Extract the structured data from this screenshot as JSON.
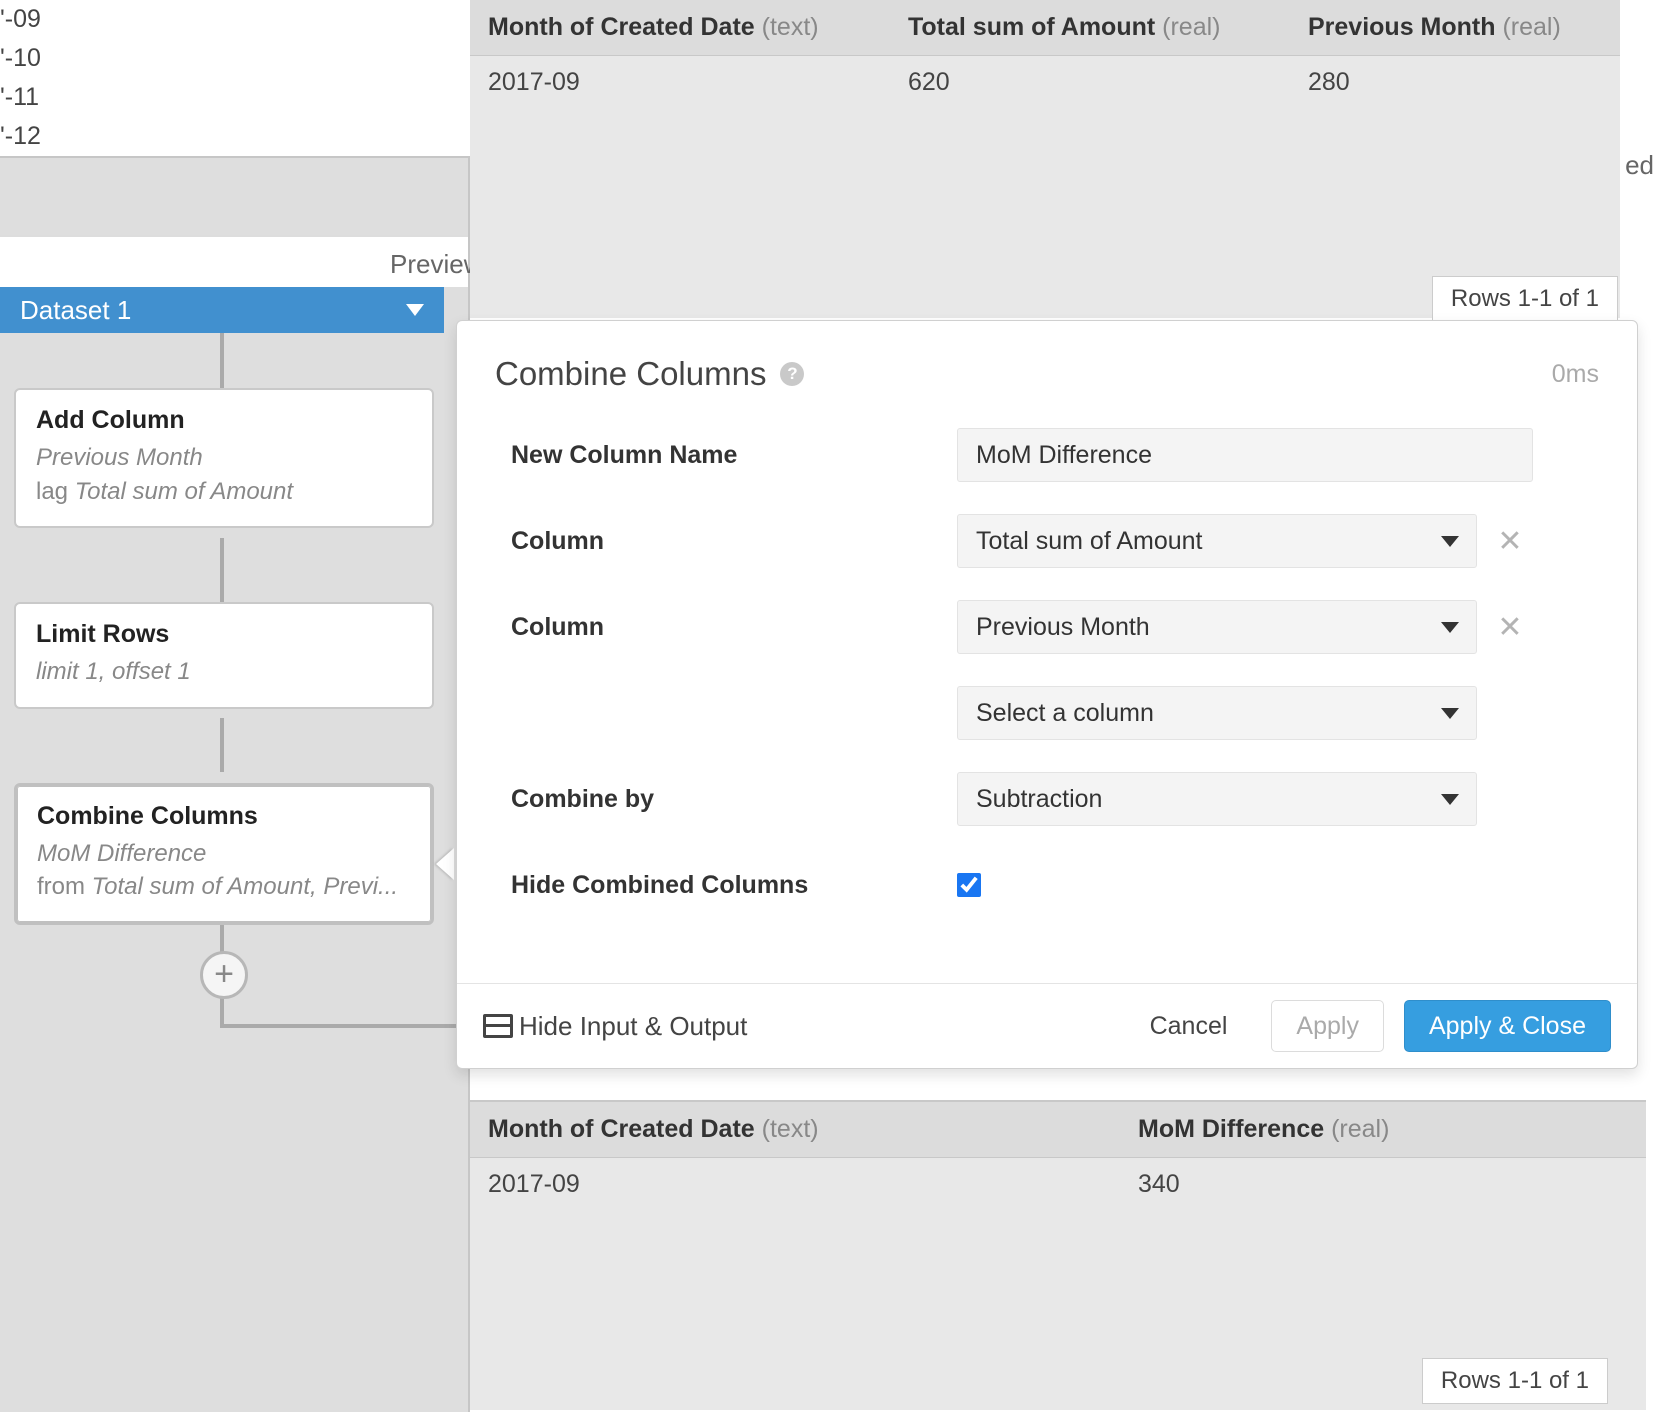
{
  "left_list": [
    "'-09",
    "'-10",
    "'-11",
    "'-12"
  ],
  "preview_tab": "Preview",
  "dataset_label": "Dataset 1",
  "pipeline": {
    "add_column": {
      "title": "Add Column",
      "sub1": "Previous Month",
      "sub2_lead": "lag ",
      "sub2_i": "Total sum of Amount"
    },
    "limit_rows": {
      "title": "Limit Rows",
      "sub": "limit 1, offset 1"
    },
    "combine_columns": {
      "title": "Combine Columns",
      "sub1": "MoM Difference",
      "sub2_lead": "from ",
      "sub2_i": "Total sum of Amount, Previ..."
    }
  },
  "input_table": {
    "headers": [
      {
        "name": "Month of Created Date",
        "type": "(text)"
      },
      {
        "name": "Total sum of Amount",
        "type": "(real)"
      },
      {
        "name": "Previous Month",
        "type": "(real)"
      }
    ],
    "row": [
      "2017-09",
      "620",
      "280"
    ],
    "rows_label": "Rows 1-1 of 1"
  },
  "dialog": {
    "title": "Combine Columns",
    "timing": "0ms",
    "labels": {
      "new_column": "New Column Name",
      "column": "Column",
      "combine_by": "Combine by",
      "hide_combined": "Hide Combined Columns"
    },
    "values": {
      "new_column": "MoM Difference",
      "col1": "Total sum of Amount",
      "col2": "Previous Month",
      "col3_placeholder": "Select a column",
      "combine_by": "Subtraction"
    },
    "footer": {
      "hide_io": "Hide Input & Output",
      "cancel": "Cancel",
      "apply": "Apply",
      "apply_close": "Apply & Close"
    }
  },
  "output_table": {
    "headers": [
      {
        "name": "Month of Created Date",
        "type": "(text)"
      },
      {
        "name": "MoM Difference",
        "type": "(real)"
      }
    ],
    "row": [
      "2017-09",
      "340"
    ],
    "rows_label": "Rows 1-1 of 1"
  },
  "edge_text": "ed"
}
